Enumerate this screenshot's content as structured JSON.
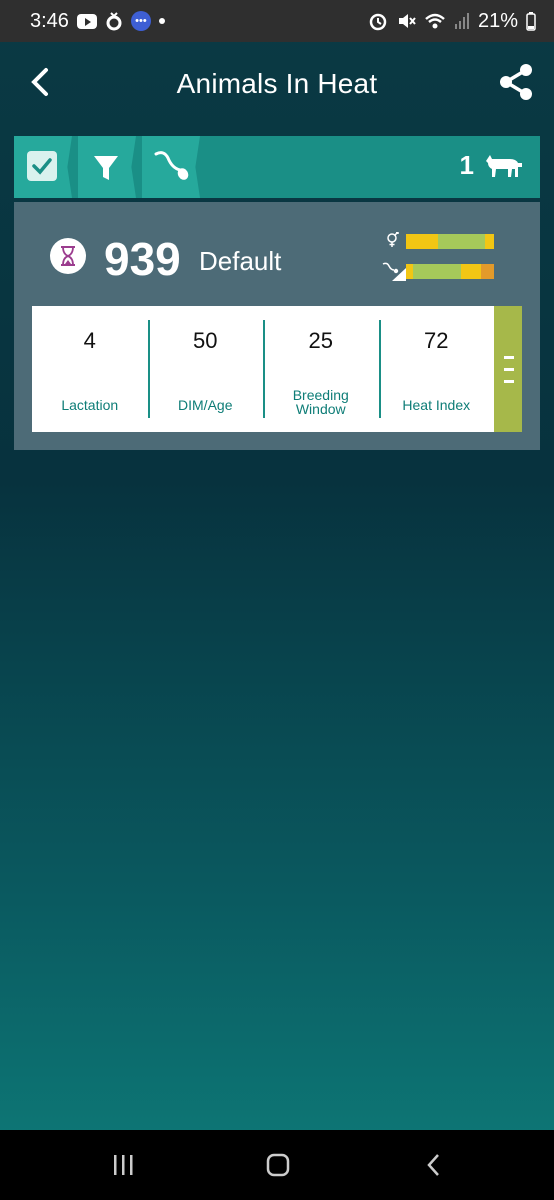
{
  "status_bar": {
    "time": "3:46",
    "battery": "21%"
  },
  "header": {
    "title": "Animals In Heat"
  },
  "toolbar": {
    "count": "1"
  },
  "card": {
    "animal_id": "939",
    "group": "Default",
    "heat_bar_segments": [
      {
        "color": "#f2c614",
        "fraction": 0.36
      },
      {
        "color": "#a6c95a",
        "fraction": 0.54
      },
      {
        "color": "#f2c614",
        "fraction": 0.1
      }
    ],
    "breeding_bar_segments": [
      {
        "color": "#f2c614",
        "fraction": 0.08
      },
      {
        "color": "#a6c95a",
        "fraction": 0.55
      },
      {
        "color": "#f2c614",
        "fraction": 0.22
      },
      {
        "color": "#e39a2a",
        "fraction": 0.15
      }
    ]
  },
  "stats": [
    {
      "value": "4",
      "label": "Lactation"
    },
    {
      "value": "50",
      "label": "DIM/Age"
    },
    {
      "value": "25",
      "label": "Breeding Window"
    },
    {
      "value": "72",
      "label": "Heat Index"
    }
  ],
  "colors": {
    "accent": "#1a8f86",
    "card": "#4d6b77",
    "handle": "#a6b84a"
  }
}
